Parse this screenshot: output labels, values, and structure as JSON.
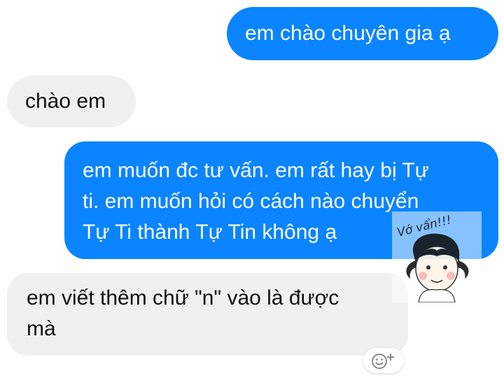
{
  "messages": [
    {
      "direction": "sent",
      "lines": [
        "em chào chuyên gia ạ"
      ]
    },
    {
      "direction": "received",
      "lines": [
        "chào em"
      ]
    },
    {
      "direction": "sent",
      "lines": [
        "em muốn đc tư vấn. em rất hay bị Tự",
        "ti. em muốn hỏi có cách nào chuyển",
        "Tự Ti thành Tự Tin không ạ"
      ]
    },
    {
      "direction": "received",
      "lines": [
        "em viết thêm chữ \"n\" vào là được",
        "mà"
      ]
    }
  ],
  "watermark": {
    "text": "Vớ vẩn!!!"
  },
  "colors": {
    "sent_bubble": "#0a84ff",
    "received_bubble": "#f0f0f0",
    "sent_text": "#ffffff",
    "received_text": "#111111"
  },
  "icons": {
    "reaction": "smiley-plus-icon"
  }
}
